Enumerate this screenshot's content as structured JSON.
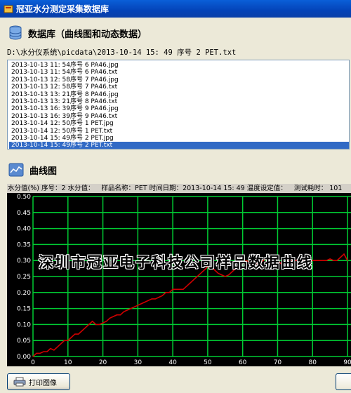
{
  "window": {
    "title": "冠亚水分测定采集数据库"
  },
  "database_section": {
    "title": "数据库（曲线图和动态数据）"
  },
  "file_path": "D:\\水分仪系统\\picdata\\2013-10-14  15: 49 序号 2 PET.txt",
  "files": [
    "2013-10-13 11: 54序号 6 PA46.jpg",
    "2013-10-13 11: 54序号 6 PA46.txt",
    "2013-10-13 12: 58序号 7 PA46.jpg",
    "2013-10-13 12: 58序号 7 PA46.txt",
    "2013-10-13 13: 21序号 8 PA46.jpg",
    "2013-10-13 13: 21序号 8 PA46.txt",
    "2013-10-13 16: 39序号 9 PA46.jpg",
    "2013-10-13 16: 39序号 9 PA46.txt",
    "2013-10-14 12: 50序号 1 PET.jpg",
    "2013-10-14 12: 50序号 1 PET.txt",
    "2013-10-14 15: 49序号 2 PET.jpg",
    "2013-10-14 15: 49序号 2 PET.txt"
  ],
  "selected_file_index": 11,
  "chart_section": {
    "title": "曲线图"
  },
  "chart_header": {
    "moisture": "水分值(%) 序号：2 水分值：",
    "sample": "样品名称：PET 时间日期：2013-10-14 15: 49 温度设定值：",
    "elapsed": "测试耗时： 101"
  },
  "watermark": "深圳市冠亚电子科技公司样品数据曲线",
  "buttons": {
    "print": "打印图像"
  },
  "colors": {
    "grid": "#00cc33",
    "curve": "#d00000",
    "plot_bg": "#000000",
    "selection": "#316ac5"
  },
  "chart_data": {
    "type": "line",
    "title": "",
    "xlabel": "",
    "ylabel": "",
    "xlim": [
      0,
      90
    ],
    "ylim": [
      0,
      0.5
    ],
    "xticks": [
      0,
      10,
      20,
      30,
      40,
      50,
      60,
      70,
      80,
      90
    ],
    "yticks": [
      0,
      0.05,
      0.1,
      0.15,
      0.2,
      0.25,
      0.3,
      0.35,
      0.4,
      0.45,
      0.5
    ],
    "grid": true,
    "series": [
      {
        "x": [
          0,
          1,
          2,
          3,
          4,
          5,
          6,
          7,
          8,
          9,
          10,
          11,
          12,
          13,
          14,
          15,
          16,
          17,
          18,
          19,
          20,
          21,
          22,
          23,
          24,
          25,
          26,
          27,
          28,
          29,
          30,
          31,
          32,
          33,
          34,
          35,
          36,
          37,
          38,
          39,
          40,
          41,
          42,
          43,
          44,
          45,
          46,
          47,
          48,
          49,
          50,
          51,
          52,
          53,
          54,
          55,
          56,
          57,
          58,
          59,
          60,
          61,
          62,
          63,
          64,
          65,
          66,
          67,
          68,
          69,
          70,
          71,
          72,
          73,
          74,
          75,
          76,
          77,
          78,
          79,
          80,
          81,
          82,
          83,
          84,
          85,
          86,
          87,
          88,
          89,
          90
        ],
        "y": [
          0.0,
          0.01,
          0.01,
          0.015,
          0.015,
          0.025,
          0.02,
          0.03,
          0.04,
          0.05,
          0.05,
          0.06,
          0.07,
          0.07,
          0.08,
          0.09,
          0.1,
          0.11,
          0.1,
          0.1,
          0.105,
          0.11,
          0.12,
          0.125,
          0.13,
          0.13,
          0.14,
          0.145,
          0.15,
          0.155,
          0.16,
          0.165,
          0.17,
          0.175,
          0.18,
          0.18,
          0.185,
          0.19,
          0.2,
          0.2,
          0.21,
          0.21,
          0.21,
          0.21,
          0.22,
          0.23,
          0.24,
          0.25,
          0.26,
          0.27,
          0.28,
          0.28,
          0.27,
          0.26,
          0.255,
          0.25,
          0.255,
          0.265,
          0.275,
          0.28,
          0.29,
          0.3,
          0.295,
          0.285,
          0.29,
          0.295,
          0.3,
          0.31,
          0.305,
          0.3,
          0.3,
          0.29,
          0.295,
          0.3,
          0.3,
          0.3,
          0.3,
          0.3,
          0.3,
          0.3,
          0.3,
          0.3,
          0.3,
          0.3,
          0.3,
          0.305,
          0.3,
          0.3,
          0.31,
          0.32,
          0.3
        ]
      }
    ]
  }
}
